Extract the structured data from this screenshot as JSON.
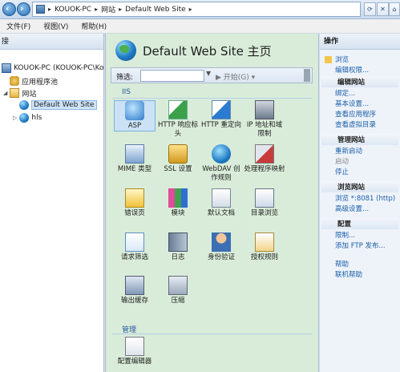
{
  "addressbar": {
    "crumbs": [
      "KOUOK-PC",
      "网站",
      "Default Web Site"
    ],
    "separator": "▸"
  },
  "menubar": [
    "文件(F)",
    "视图(V)",
    "帮助(H)"
  ],
  "left": {
    "header": "接",
    "tree": [
      {
        "label": "KOUOK-PC (KOUOK-PC\\Ko",
        "level": 0
      },
      {
        "label": "应用程序池",
        "level": 1
      },
      {
        "label": "网站",
        "level": 1
      },
      {
        "label": "Default Web Site",
        "level": 2,
        "selected": true
      },
      {
        "label": "hls",
        "level": 2
      }
    ]
  },
  "main": {
    "title": "Default Web Site 主页",
    "filter_label": "筛选:",
    "filter_go": "开始(G)",
    "sections": [
      {
        "name": "IIS",
        "features": [
          {
            "label": "ASP",
            "icon": "asp-icon",
            "selected": true
          },
          {
            "label": "HTTP 响应标头",
            "icon": "http-headers-icon"
          },
          {
            "label": "HTTP 重定向",
            "icon": "http-redirect-icon"
          },
          {
            "label": "IP 地址和域限制",
            "icon": "ip-restrictions-icon"
          },
          {
            "label": "MIME 类型",
            "icon": "mime-types-icon"
          },
          {
            "label": "SSL 设置",
            "icon": "ssl-lock-icon"
          },
          {
            "label": "WebDAV 创作规则",
            "icon": "webdav-icon"
          },
          {
            "label": "处理程序映射",
            "icon": "handler-mappings-icon"
          },
          {
            "label": "错误页",
            "icon": "error-pages-icon"
          },
          {
            "label": "模块",
            "icon": "modules-icon"
          },
          {
            "label": "默认文档",
            "icon": "default-document-icon"
          },
          {
            "label": "目录浏览",
            "icon": "directory-browsing-icon"
          },
          {
            "label": "请求筛选",
            "icon": "request-filtering-icon"
          },
          {
            "label": "日志",
            "icon": "logging-icon"
          },
          {
            "label": "身份验证",
            "icon": "authentication-icon"
          },
          {
            "label": "授权规则",
            "icon": "authorization-rules-icon"
          },
          {
            "label": "输出缓存",
            "icon": "output-caching-icon"
          },
          {
            "label": "压缩",
            "icon": "compression-icon"
          }
        ]
      },
      {
        "name": "管理",
        "features": [
          {
            "label": "配置编辑器",
            "icon": "configuration-editor-icon"
          }
        ]
      }
    ]
  },
  "right": {
    "header": "操作",
    "top_actions": [
      "浏览",
      "编辑权限..."
    ],
    "groups": [
      {
        "title": "编辑网站",
        "items": [
          {
            "label": "绑定...",
            "disabled": false
          },
          {
            "label": "基本设置...",
            "disabled": false
          },
          {
            "label": "查看应用程序",
            "disabled": false
          },
          {
            "label": "查看虚拟目录",
            "disabled": false
          }
        ]
      },
      {
        "title": "管理网站",
        "items": [
          {
            "label": "重新启动",
            "disabled": false
          },
          {
            "label": "启动",
            "disabled": true
          },
          {
            "label": "停止",
            "disabled": false
          }
        ]
      },
      {
        "title": "浏览网站",
        "items": [
          {
            "label": "浏览 *:8081 (http)",
            "disabled": false
          },
          {
            "label": "高级设置...",
            "disabled": false
          }
        ]
      },
      {
        "title": "配置",
        "items": [
          {
            "label": "限制...",
            "disabled": false
          },
          {
            "label": "添加 FTP 发布...",
            "disabled": false
          }
        ]
      },
      {
        "title": "",
        "items": [
          {
            "label": "帮助",
            "disabled": false
          },
          {
            "label": "联机帮助",
            "disabled": false
          }
        ]
      }
    ]
  }
}
